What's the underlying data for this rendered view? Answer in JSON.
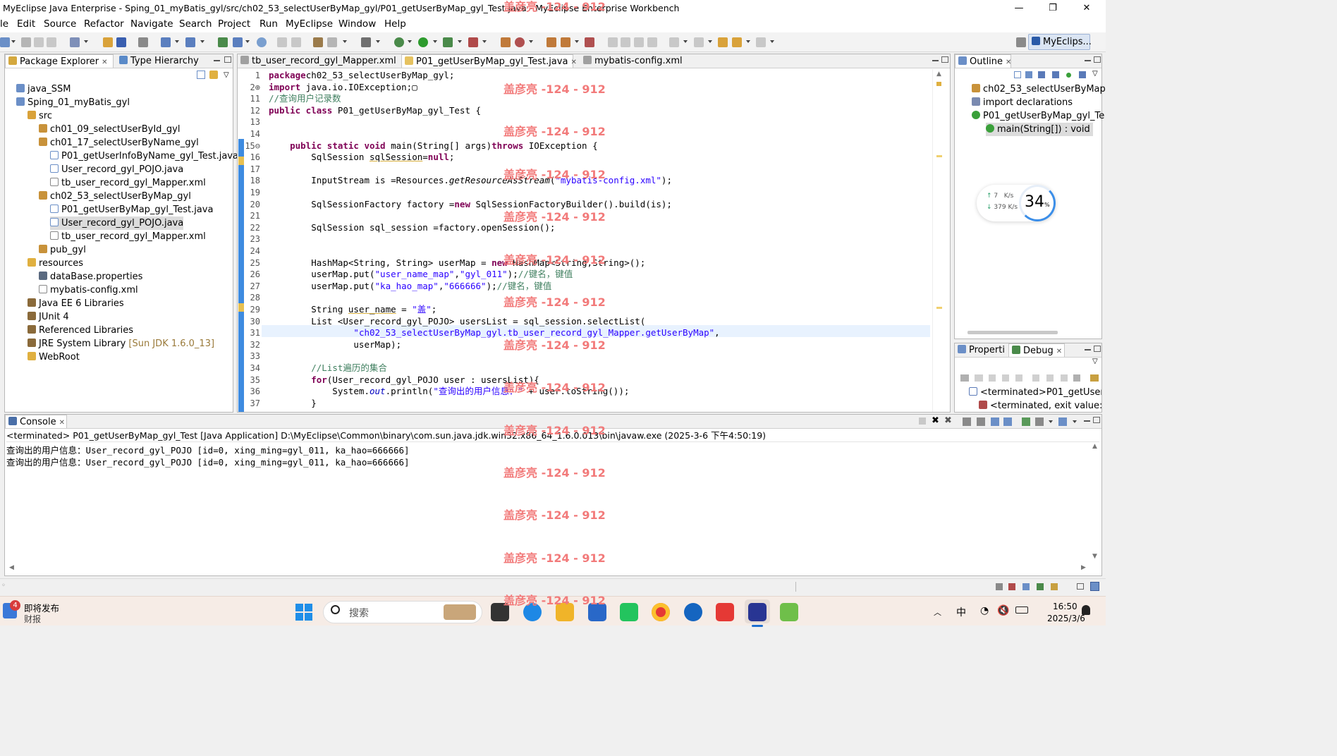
{
  "window": {
    "title": "MyEclipse Java Enterprise - Sping_01_myBatis_gyl/src/ch02_53_selectUserByMap_gyl/P01_getUserByMap_gyl_Test.java - MyEclipse Enterprise Workbench",
    "minimize_glyph": "—",
    "restore_glyph": "❐",
    "close_glyph": "✕"
  },
  "menu": [
    "le",
    "Edit",
    "Source",
    "Refactor",
    "Navigate",
    "Search",
    "Project",
    "Run",
    "MyEclipse",
    "Window",
    "Help"
  ],
  "perspective": {
    "label": "MyEclips..."
  },
  "package_explorer": {
    "tabs": [
      "Package Explorer",
      "Type Hierarchy"
    ],
    "items": [
      {
        "label": "java_SSM",
        "icon": "project-icon"
      },
      {
        "label": "Sping_01_myBatis_gyl",
        "icon": "project-icon"
      },
      {
        "label": "src",
        "icon": "source-folder-icon"
      },
      {
        "label": "ch01_09_selectUserById_gyl",
        "icon": "package-icon"
      },
      {
        "label": "ch01_17_selectUserByName_gyl",
        "icon": "package-icon"
      },
      {
        "label": "P01_getUserInfoByName_gyl_Test.java",
        "icon": "java-file-icon"
      },
      {
        "label": "User_record_gyl_POJO.java",
        "icon": "java-file-icon"
      },
      {
        "label": "tb_user_record_gyl_Mapper.xml",
        "icon": "xml-file-icon"
      },
      {
        "label": "ch02_53_selectUserByMap_gyl",
        "icon": "package-icon"
      },
      {
        "label": "P01_getUserByMap_gyl_Test.java",
        "icon": "java-file-icon"
      },
      {
        "label": "User_record_gyl_POJO.java",
        "icon": "java-file-icon"
      },
      {
        "label": "tb_user_record_gyl_Mapper.xml",
        "icon": "xml-file-icon"
      },
      {
        "label": "pub_gyl",
        "icon": "package-icon"
      },
      {
        "label": "resources",
        "icon": "folder-icon"
      },
      {
        "label": "dataBase.properties",
        "icon": "properties-file-icon"
      },
      {
        "label": "mybatis-config.xml",
        "icon": "xml-file-icon"
      },
      {
        "label": "Java EE 6 Libraries",
        "icon": "library-icon"
      },
      {
        "label": "JUnit 4",
        "icon": "library-icon"
      },
      {
        "label": "Referenced Libraries",
        "icon": "library-icon"
      },
      {
        "label": "JRE System Library",
        "suffix": "[Sun JDK 1.6.0_13]",
        "icon": "library-icon"
      },
      {
        "label": "WebRoot",
        "icon": "folder-icon"
      }
    ]
  },
  "editor": {
    "tabs": [
      "tb_user_record_gyl_Mapper.xml",
      "P01_getUserByMap_gyl_Test.java",
      "mybatis-config.xml"
    ],
    "lines": [
      {
        "n": "1",
        "segs": [
          [
            "kw",
            "package"
          ],
          [
            "",
            "ch02_53_selectUserByMap_gyl;"
          ]
        ]
      },
      {
        "n": "2⊕",
        "segs": [
          [
            "kw",
            "import"
          ],
          [
            "",
            " java.io.IOException;"
          ],
          [
            "",
            "▢"
          ]
        ]
      },
      {
        "n": "11",
        "segs": [
          [
            "cmt",
            "//查询用户记录数"
          ]
        ]
      },
      {
        "n": "12",
        "segs": [
          [
            "kw",
            "public class"
          ],
          [
            "",
            " P01_getUserByMap_gyl_Test {"
          ]
        ]
      },
      {
        "n": "13",
        "segs": []
      },
      {
        "n": "14",
        "segs": []
      },
      {
        "n": "15⊖",
        "segs": [
          [
            "",
            "    "
          ],
          [
            "kw",
            "public static void"
          ],
          [
            "",
            " main(String[] args)"
          ],
          [
            "kw",
            "throws"
          ],
          [
            "",
            " IOException {"
          ]
        ]
      },
      {
        "n": "16",
        "segs": [
          [
            "",
            "        SqlSession "
          ],
          [
            "und",
            "sqlSession"
          ],
          [
            "",
            "="
          ],
          [
            "kw",
            "null"
          ],
          [
            "",
            ";"
          ]
        ]
      },
      {
        "n": "17",
        "segs": []
      },
      {
        "n": "18",
        "segs": [
          [
            "",
            "        InputStream is =Resources."
          ],
          [
            "ita",
            "getResourceAsStream"
          ],
          [
            "",
            "("
          ],
          [
            "str",
            "\"mybatis-config.xml\""
          ],
          [
            "",
            ");"
          ]
        ]
      },
      {
        "n": "19",
        "segs": []
      },
      {
        "n": "20",
        "segs": [
          [
            "",
            "        SqlSessionFactory factory ="
          ],
          [
            "kw",
            "new"
          ],
          [
            "",
            " SqlSessionFactoryBuilder().build(is);"
          ]
        ]
      },
      {
        "n": "21",
        "segs": []
      },
      {
        "n": "22",
        "segs": [
          [
            "",
            "        SqlSession sql_session =factory.openSession();"
          ]
        ]
      },
      {
        "n": "23",
        "segs": []
      },
      {
        "n": "24",
        "segs": []
      },
      {
        "n": "25",
        "segs": [
          [
            "",
            "        HashMap<String, String> userMap = "
          ],
          [
            "kw",
            "new"
          ],
          [
            "",
            " HashMap<String,String>();"
          ]
        ]
      },
      {
        "n": "26",
        "segs": [
          [
            "",
            "        userMap.put("
          ],
          [
            "str",
            "\"user_name_map\""
          ],
          [
            "",
            ","
          ],
          [
            "str",
            "\"gyl_011\""
          ],
          [
            "",
            ");"
          ],
          [
            "cmt",
            "//键名，键值"
          ]
        ]
      },
      {
        "n": "27",
        "segs": [
          [
            "",
            "        userMap.put("
          ],
          [
            "str",
            "\"ka_hao_map\""
          ],
          [
            "",
            ","
          ],
          [
            "str",
            "\"666666\""
          ],
          [
            "",
            ");"
          ],
          [
            "cmt",
            "//键名，键值"
          ]
        ]
      },
      {
        "n": "28",
        "segs": []
      },
      {
        "n": "29",
        "segs": [
          [
            "",
            "        String "
          ],
          [
            "und",
            "user_name"
          ],
          [
            "",
            " = "
          ],
          [
            "str",
            "\"盖\""
          ],
          [
            "",
            ";"
          ]
        ]
      },
      {
        "n": "30",
        "segs": [
          [
            "",
            "        List <User_record_gyl_POJO> usersList = sql_session.selectList("
          ]
        ]
      },
      {
        "n": "31",
        "segs": [
          [
            "",
            "                "
          ],
          [
            "str",
            "\"ch02_53_selectUserByMap_gyl.tb_user_record_gyl_Mapper.getUserByMap\""
          ],
          [
            "",
            ","
          ]
        ]
      },
      {
        "n": "32",
        "segs": [
          [
            "",
            "                userMap);"
          ]
        ]
      },
      {
        "n": "33",
        "segs": []
      },
      {
        "n": "34",
        "segs": [
          [
            "",
            "        "
          ],
          [
            "cmt",
            "//List遍历的集合"
          ]
        ]
      },
      {
        "n": "35",
        "segs": [
          [
            "",
            "        "
          ],
          [
            "kw",
            "for"
          ],
          [
            "",
            "(User_record_gyl_POJO user : usersList){"
          ]
        ]
      },
      {
        "n": "36",
        "segs": [
          [
            "",
            "            System."
          ],
          [
            "ita2",
            "out"
          ],
          [
            "",
            ".println("
          ],
          [
            "str",
            "\"查询出的用户信息：\""
          ],
          [
            "",
            " + user.toString());"
          ]
        ]
      },
      {
        "n": "37",
        "segs": [
          [
            "",
            "        }"
          ]
        ]
      }
    ]
  },
  "outline": {
    "tab": "Outline",
    "items": [
      {
        "label": "ch02_53_selectUserByMap",
        "icon": "package-icon"
      },
      {
        "label": "import declarations",
        "icon": "imports-icon"
      },
      {
        "label": "P01_getUserByMap_gyl_Te",
        "icon": "class-icon"
      },
      {
        "label": "main(String[]) : void",
        "icon": "method-icon"
      }
    ]
  },
  "net_widget": {
    "up": "7",
    "up_unit": "K/s",
    "down": "379",
    "down_unit": "K/s",
    "percent": "34",
    "percent_unit": "%",
    "up_arrow": "↑",
    "down_arrow": "↓"
  },
  "debug": {
    "tabs": [
      "Properti",
      "Debug"
    ],
    "items": [
      "<terminated>P01_getUserBy",
      "<terminated, exit value: 0:"
    ]
  },
  "console": {
    "tab": "Console",
    "header": "<terminated> P01_getUserByMap_gyl_Test [Java Application] D:\\MyEclipse\\Common\\binary\\com.sun.java.jdk.win32.x86_64_1.6.0.013\\bin\\javaw.exe (2025-3-6 下午4:50:19)",
    "lines": [
      "查询出的用户信息：User_record_gyl_POJO [id=0, xing_ming=gyl_011, ka_hao=666666]",
      "查询出的用户信息：User_record_gyl_POJO [id=0, xing_ming=gyl_011, ka_hao=666666]"
    ]
  },
  "watermark": "盖彦亮 -124 - 912",
  "taskbar": {
    "news_badge": "4",
    "news_title": "即将发布",
    "news_sub": "财报",
    "search_placeholder": "搜索",
    "ime": "中",
    "time": "16:50",
    "date": "2025/3/6"
  },
  "colors": {
    "keyword": "#7f0055",
    "string": "#2a00ff",
    "comment": "#3f7f5f",
    "watermark": "#f27a7a",
    "accent": "#1e6fd0"
  }
}
